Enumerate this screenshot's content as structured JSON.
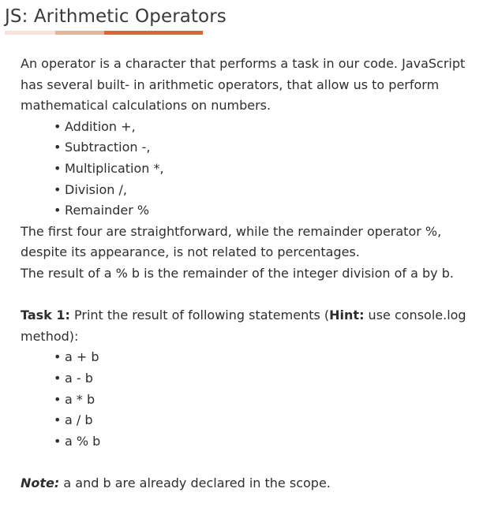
{
  "header": {
    "title": "JS: Arithmetic Operators"
  },
  "intro": {
    "paragraph": "An operator is a character that performs a task in our code. JavaScript has several built- in arithmetic operators, that allow us to perform mathematical calculations on numbers.",
    "operators": [
      "Addition +,",
      "Subtraction -,",
      "Multiplication *,",
      "Division /,",
      "Remainder %"
    ],
    "line1": "The first four are straightforward, while the remainder operator %, despite its appearance, is not related to percentages.",
    "line2": "The result of a % b is the remainder of the integer division of a by b."
  },
  "task": {
    "label": "Task 1:",
    "text_before_hint": " Print the result of following statements (",
    "hint_label": "Hint:",
    "text_after_hint": " use console.log method):",
    "statements": [
      "a + b",
      "a - b",
      "a * b",
      "a / b",
      "a % b"
    ]
  },
  "note": {
    "label": "Note:",
    "text": " a and b are already declared in the scope."
  },
  "colors": {
    "accent": "#d9653b",
    "accent_mid": "#e3b59b",
    "accent_light": "#f8e3dc"
  }
}
